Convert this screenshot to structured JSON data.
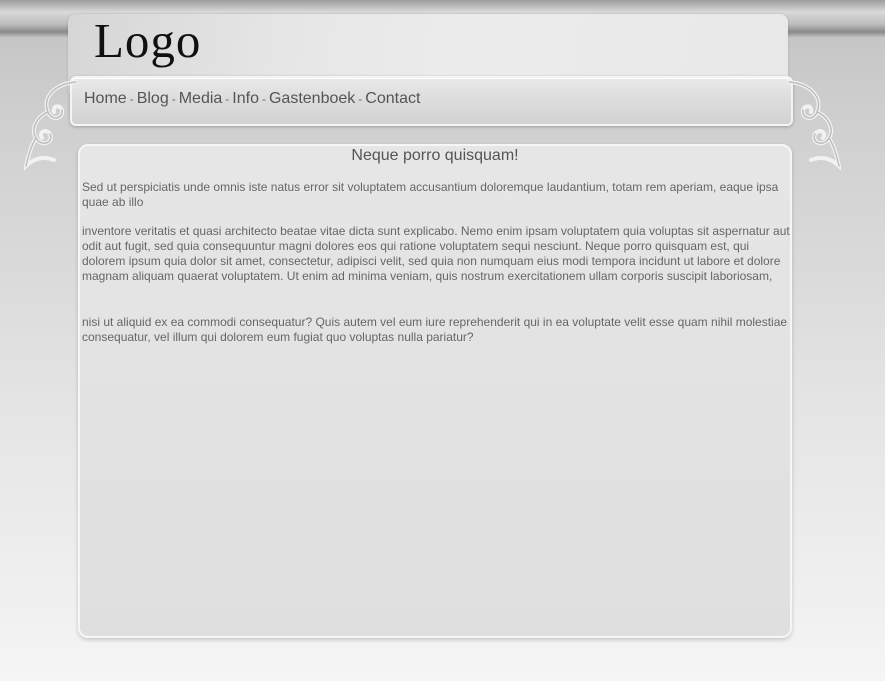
{
  "header": {
    "logo_text": "Logo"
  },
  "nav": {
    "items": [
      "Home",
      "Blog",
      "Media",
      "Info",
      "Gastenboek",
      "Contact"
    ],
    "separator": "-"
  },
  "content": {
    "title": "Neque porro quisquam!",
    "paragraphs": [
      "Sed ut perspiciatis unde omnis iste natus error sit voluptatem accusantium doloremque laudantium, totam rem aperiam, eaque ipsa quae ab illo",
      "inventore veritatis et quasi architecto beatae vitae dicta sunt explicabo. Nemo enim ipsam voluptatem quia voluptas sit aspernatur aut odit aut fugit, sed quia consequuntur magni dolores eos qui ratione voluptatem sequi nesciunt. Neque porro quisquam est, qui dolorem ipsum quia dolor sit amet, consectetur, adipisci velit, sed quia non numquam eius modi tempora incidunt ut labore et dolore magnam aliquam quaerat voluptatem. Ut enim ad minima veniam, quis nostrum exercitationem ullam corporis suscipit laboriosam,",
      "nisi ut aliquid ex ea commodi consequatur? Quis autem vel eum iure reprehenderit qui in ea voluptate velit esse quam nihil molestiae consequatur, vel illum qui dolorem eum fugiat quo voluptas nulla pariatur?"
    ]
  },
  "ornaments": {
    "left_icon": "scroll-ornament-icon",
    "right_icon": "scroll-ornament-icon"
  }
}
